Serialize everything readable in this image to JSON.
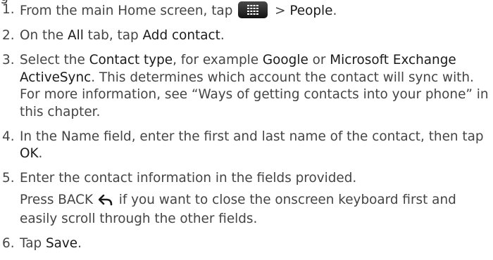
{
  "clipped_heading": "g",
  "steps": [
    {
      "n": "1.",
      "pre": "From the main Home screen, tap ",
      "icon": "all-apps-grid-icon",
      "sep": " > ",
      "target": "People",
      "post": "."
    },
    {
      "n": "2.",
      "pre": "On the ",
      "em1": "All",
      "mid": " tab, tap ",
      "em2": "Add contact",
      "post": "."
    },
    {
      "n": "3.",
      "pre": "Select the ",
      "em1": "Contact type",
      "mid1": ", for example ",
      "em2": "Google",
      "mid2": " or ",
      "em3": "Microsoft Exchange ActiveSync",
      "post": ". This determines which account the contact will sync with. For more information, see “Ways of getting contacts into your phone” in this chapter."
    },
    {
      "n": "4.",
      "pre": "In the Name field, enter the first and last name of the contact, then tap ",
      "em1": "OK",
      "post": "."
    },
    {
      "n": "5.",
      "pre": "Enter the contact information in the fields provided.",
      "sub_pre": "Press BACK ",
      "sub_icon": "back-arrow-icon",
      "sub_post": " if you want to close the onscreen keyboard first and easily scroll through the other fields."
    },
    {
      "n": "6.",
      "pre": "Tap ",
      "em1": "Save",
      "post": "."
    }
  ],
  "colors": {
    "text": "#444444",
    "emphasis": "#1a1a1a"
  }
}
